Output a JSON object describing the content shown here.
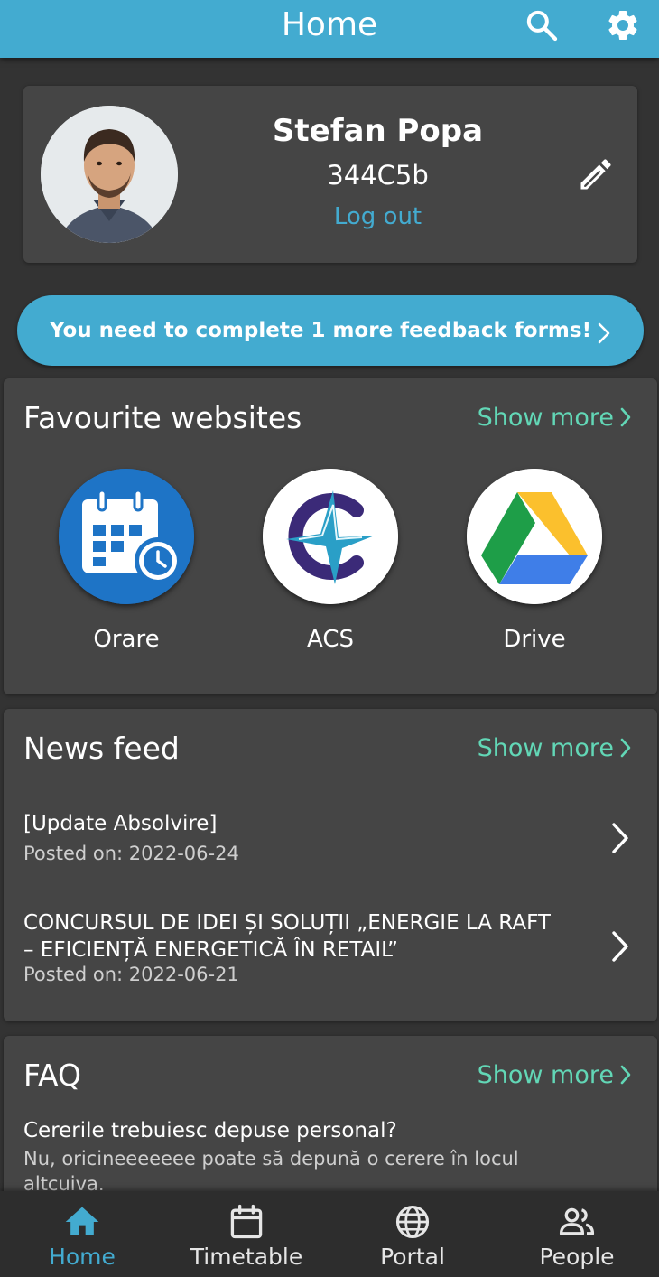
{
  "colors": {
    "primary": "#43abd0",
    "accent": "#62d7b6",
    "background": "#333333",
    "card": "#454545",
    "nav_background": "#2d2d2d"
  },
  "appbar": {
    "title": "Home",
    "icons": [
      "search-icon",
      "gear-icon"
    ]
  },
  "profile": {
    "name": "Stefan Popa",
    "group": "344C5b",
    "logout_label": "Log out",
    "icons": [
      "avatar",
      "pencil-icon"
    ]
  },
  "feedback_banner": {
    "text": "You need to complete 1 more feedback forms!"
  },
  "favourites": {
    "title": "Favourite websites",
    "show_more": "Show more",
    "items": [
      {
        "label": "Orare",
        "icon": "calendar-clock-icon"
      },
      {
        "label": "ACS",
        "icon": "acs-logo-icon"
      },
      {
        "label": "Drive",
        "icon": "google-drive-icon"
      }
    ]
  },
  "news": {
    "title": "News feed",
    "show_more": "Show more",
    "items": [
      {
        "title": "[Update Absolvire]",
        "date": "Posted on: 2022-06-24"
      },
      {
        "title": "CONCURSUL DE IDEI ȘI SOLUȚII „ENERGIE LA RAFT – EFICIENȚĂ ENERGETICĂ ÎN RETAIL”",
        "date": "Posted on: 2022-06-21"
      }
    ]
  },
  "faq": {
    "title": "FAQ",
    "show_more": "Show more",
    "items": [
      {
        "question": "Cererile trebuiesc depuse personal?",
        "answer": "Nu, oricineeeeeee poate să depună o cerere în locul altcuiva."
      }
    ]
  },
  "bottom_nav": {
    "active": "Home",
    "items": [
      {
        "label": "Home",
        "icon": "home-icon"
      },
      {
        "label": "Timetable",
        "icon": "calendar-icon"
      },
      {
        "label": "Portal",
        "icon": "globe-icon"
      },
      {
        "label": "People",
        "icon": "people-icon"
      }
    ]
  }
}
